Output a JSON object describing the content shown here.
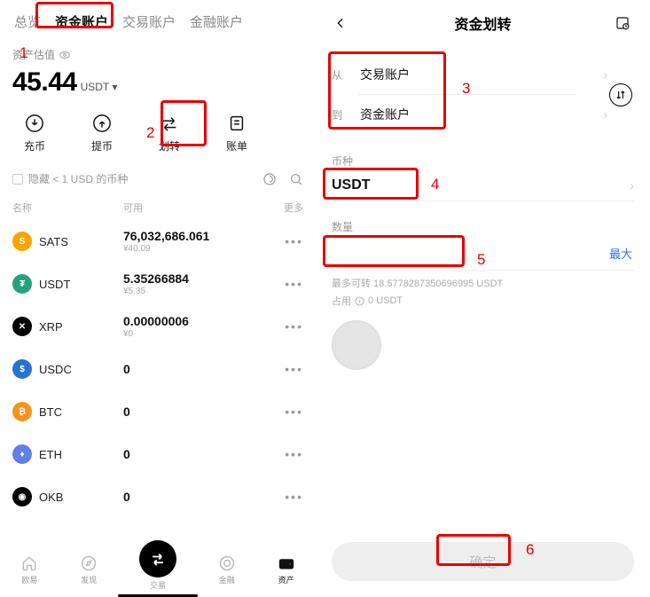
{
  "left": {
    "tabs": [
      "总览",
      "资金账户",
      "交易账户",
      "金融账户"
    ],
    "active_tab_index": 1,
    "asset_label": "资产估值",
    "asset_amount": "45.44",
    "asset_unit": "USDT",
    "actions": [
      {
        "label": "充币",
        "name": "deposit"
      },
      {
        "label": "提币",
        "name": "withdraw"
      },
      {
        "label": "划转",
        "name": "transfer"
      },
      {
        "label": "账单",
        "name": "bills"
      }
    ],
    "hide_small_label": "隐藏 < 1 USD 的币种",
    "columns": {
      "name": "名称",
      "available": "可用",
      "more": "更多"
    },
    "assets": [
      {
        "sym": "SATS",
        "amt": "76,032,686.061",
        "sub": "¥40.09",
        "color": "#f7a600",
        "glyph": "S"
      },
      {
        "sym": "USDT",
        "amt": "5.35266884",
        "sub": "¥5.35",
        "color": "#26a17b",
        "glyph": "₮"
      },
      {
        "sym": "XRP",
        "amt": "0.00000006",
        "sub": "¥0",
        "color": "#000000",
        "glyph": "✕"
      },
      {
        "sym": "USDC",
        "amt": "0",
        "sub": "",
        "color": "#2775ca",
        "glyph": "$"
      },
      {
        "sym": "BTC",
        "amt": "0",
        "sub": "",
        "color": "#f7931a",
        "glyph": "₿"
      },
      {
        "sym": "ETH",
        "amt": "0",
        "sub": "",
        "color": "#627eea",
        "glyph": "♦"
      },
      {
        "sym": "OKB",
        "amt": "0",
        "sub": "",
        "color": "#000000",
        "glyph": "◉"
      }
    ],
    "nav": [
      {
        "label": "欧易",
        "name": "home"
      },
      {
        "label": "发现",
        "name": "discover"
      },
      {
        "label": "交易",
        "name": "trade"
      },
      {
        "label": "金融",
        "name": "finance"
      },
      {
        "label": "资产",
        "name": "assets"
      }
    ]
  },
  "right": {
    "title": "资金划转",
    "from_label": "从",
    "from_value": "交易账户",
    "to_label": "到",
    "to_value": "资金账户",
    "currency_label": "币种",
    "currency_value": "USDT",
    "amount_label": "数量",
    "amount_value": "",
    "max_label": "最大",
    "max_transfer_hint": "最多可转 18.5778287350696995 USDT",
    "occupied_label": "占用",
    "occupied_value": "0 USDT",
    "confirm_label": "确定"
  },
  "callouts": {
    "n1": "1",
    "n2": "2",
    "n3": "3",
    "n4": "4",
    "n5": "5",
    "n6": "6"
  }
}
